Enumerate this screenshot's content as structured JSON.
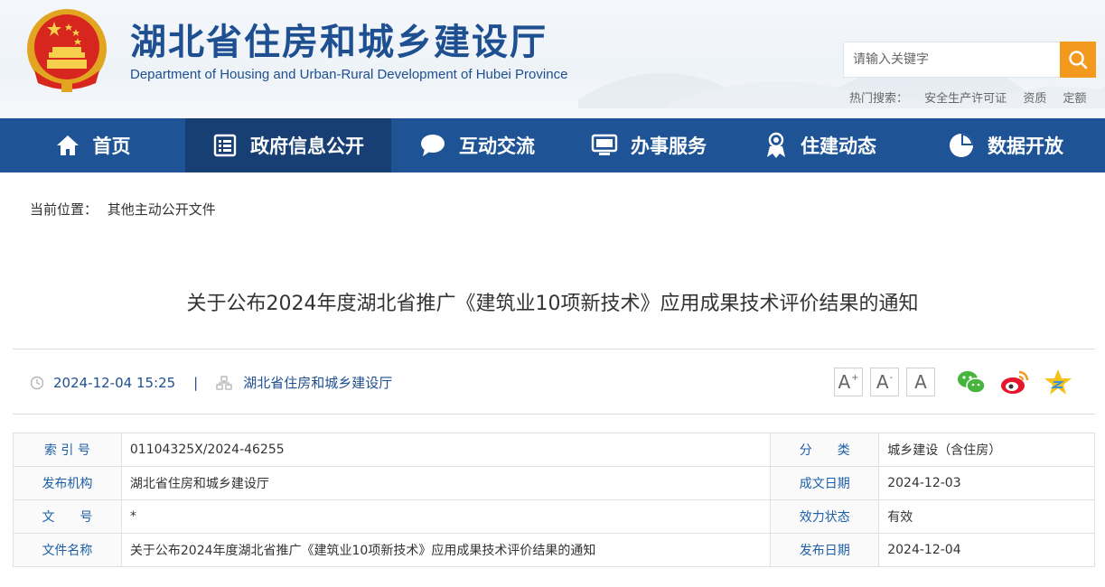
{
  "header": {
    "title": "湖北省住房和城乡建设厅",
    "subtitle": "Department of Housing and Urban-Rural Development of Hubei Province",
    "search_placeholder": "请输入关键字",
    "hot_label": "热门搜索：",
    "hot_links": [
      "安全生产许可证",
      "资质",
      "定额"
    ]
  },
  "nav": {
    "items": [
      {
        "label": "首页",
        "icon": "home-icon"
      },
      {
        "label": "政府信息公开",
        "icon": "document-list-icon"
      },
      {
        "label": "互动交流",
        "icon": "chat-bubble-icon"
      },
      {
        "label": "办事服务",
        "icon": "monitor-icon"
      },
      {
        "label": "住建动态",
        "icon": "person-badge-icon"
      },
      {
        "label": "数据开放",
        "icon": "pie-chart-icon"
      }
    ],
    "active_index": 1
  },
  "breadcrumb": {
    "label": "当前位置：",
    "current": "其他主动公开文件"
  },
  "article": {
    "title": "关于公布2024年度湖北省推广《建筑业10项新技术》应用成果技术评价结果的通知",
    "datetime": "2024-12-04 15:25",
    "separator": "|",
    "source": "湖北省住房和城乡建设厅"
  },
  "font_controls": [
    "A",
    "A",
    "A"
  ],
  "font_marks": [
    "+",
    "-"
  ],
  "share_icons": [
    "wechat-icon",
    "weibo-icon",
    "qzone-icon"
  ],
  "info_table": {
    "rows": [
      {
        "l1": "索 引 号",
        "v1": "01104325X/2024-46255",
        "l2": "分　　类",
        "v2": "城乡建设（含住房）"
      },
      {
        "l1": "发布机构",
        "v1": "湖北省住房和城乡建设厅",
        "l2": "成文日期",
        "v2": "2024-12-03"
      },
      {
        "l1": "文　　号",
        "v1": "*",
        "l2": "效力状态",
        "v2": "有效"
      },
      {
        "l1": "文件名称",
        "v1": "关于公布2024年度湖北省推广《建筑业10项新技术》应用成果技术评价结果的通知",
        "l2": "发布日期",
        "v2": "2024-12-04"
      }
    ]
  },
  "colors": {
    "nav_bg": "#1e5496",
    "nav_active": "#173f73",
    "brand_blue": "#1d4f91",
    "search_orange": "#f39a1e",
    "label_blue": "#1d5fa8"
  }
}
